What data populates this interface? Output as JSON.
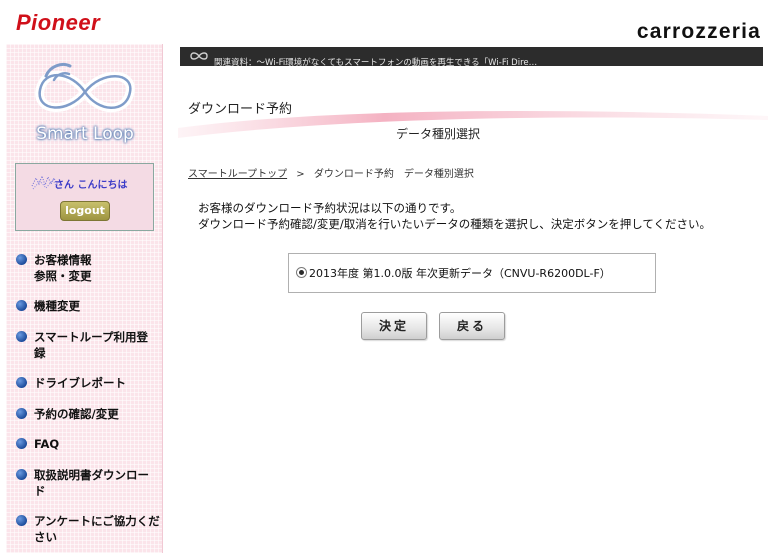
{
  "header": {
    "brand_left": "Pioneer",
    "brand_right": "carrozzeria"
  },
  "sidebar": {
    "logo_text": "Smart Loop",
    "greeting": "さん こんにちは",
    "logout_label": "logout",
    "menu": [
      {
        "line1": "お客様情報",
        "line2": "参照・変更"
      },
      {
        "line1": "機種変更",
        "line2": ""
      },
      {
        "line1": "スマートループ利用登",
        "line2": "録"
      },
      {
        "line1": "ドライブレポート",
        "line2": ""
      },
      {
        "line1": "予約の確認/変更",
        "line2": ""
      },
      {
        "line1": "FAQ",
        "line2": ""
      },
      {
        "line1": "取扱説明書ダウンロー",
        "line2": "ド"
      },
      {
        "line1": "アンケートにご協力くだ",
        "line2": "さい"
      }
    ]
  },
  "banner": {
    "text": "関連資料：～Wi-Fi環境がなくてもスマートフォンの動画を再生できる「Wi-Fi Dire…"
  },
  "page": {
    "title": "ダウンロード予約",
    "subtitle": "データ種別選択"
  },
  "breadcrumb": {
    "home": "スマートループトップ",
    "separator": ">",
    "current": "ダウンロード予約　データ種別選択"
  },
  "info": {
    "line1": "お客様のダウンロード予約状況は以下の通りです。",
    "line2": "ダウンロード予約確認/変更/取消を行いたいデータの種類を選択し、決定ボタンを押してください。"
  },
  "selection": {
    "option_label": "2013年度 第1.0.0版 年次更新データ（CNVU-R6200DL-F）",
    "selected": true
  },
  "buttons": {
    "ok": "決定",
    "back": "戻る"
  },
  "colors": {
    "brand_red": "#d0101a",
    "sidebar_pink": "#fbe4ea",
    "bullet_blue": "#1d4c9c"
  }
}
